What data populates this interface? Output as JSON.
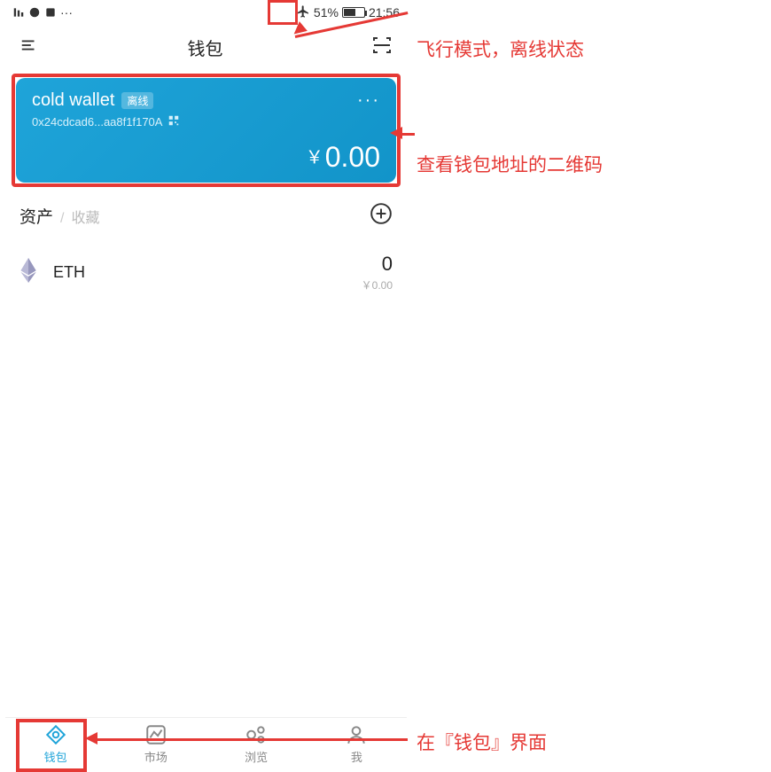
{
  "statusbar": {
    "battery_percent": "51%",
    "time": "21:56"
  },
  "header": {
    "title": "钱包"
  },
  "wallet_card": {
    "name": "cold wallet",
    "offline_badge": "离线",
    "address": "0x24cdcad6...aa8f1f170A",
    "currency_symbol": "￥",
    "balance": "0.00"
  },
  "assets": {
    "tab_assets": "资产",
    "tab_separator": "/",
    "tab_favorites": "收藏",
    "items": [
      {
        "symbol": "ETH",
        "amount": "0",
        "fiat": "￥0.00"
      }
    ]
  },
  "bottom_tabs": {
    "wallet": "钱包",
    "market": "市场",
    "browse": "浏览",
    "me": "我"
  },
  "annotations": {
    "a1": "飞行模式，离线状态",
    "a2": "查看钱包地址的二维码",
    "a3": "在『钱包』界面"
  }
}
